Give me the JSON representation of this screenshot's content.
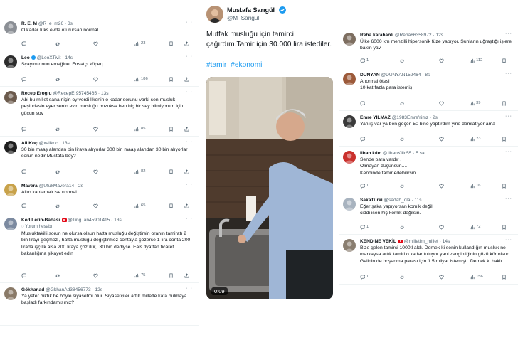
{
  "left_tweets": [
    {
      "name": "R. E. M",
      "handle": "@R_e_m26",
      "time": "3s",
      "flag": false,
      "text": "O kadar lüks evde oturursan normal",
      "note": "",
      "views": "23"
    },
    {
      "name": "Leo",
      "handle": "@LeoXTivit",
      "time": "14s",
      "flag": false,
      "verified_icon": true,
      "text": "Sçayım onun emeğine. Fırsatçı köpeq",
      "note": "",
      "views": "186"
    },
    {
      "name": "Recep Eroglu",
      "handle": "@RecepEr95745465",
      "time": "13s",
      "flag": false,
      "text": "Abi bu millet sana niçin oy verdi likenin o kadar sorunu varki sen musluk peşindesin eyer senin evin musluğu bozuksa ben hiç bir sey bilmiyorum için gücun sov",
      "note": "",
      "views": "85"
    },
    {
      "name": "Ali Koç",
      "handle": "@xalikoc",
      "time": "13s",
      "flag": false,
      "text": "30 bin maaş alandan bin liraya alıyorlar 300 bin maaş alandan 30 bin alıyorlar sorun nedir Mustafa bey?",
      "note": "",
      "views": "82"
    },
    {
      "name": "Mavera",
      "handle": "@UfukMavera14",
      "time": "2s",
      "flag": false,
      "text": "Altın kaplamalı ise normal",
      "note": "",
      "views": "65"
    },
    {
      "name": "KediLerin-Babası",
      "handle": "@TingTan45901415",
      "time": "13s",
      "flag": true,
      "text": "Musluktakilli sorun ne olursa olsun  hatta musluğu değiştirsin oranın tamiratı 2 bin lirayı geçmez , hatta musluğu değiştirmez contayla çözerse 1 lira conta 200 lirada işçilik alsa 200 liraya çözülür,, 30 bin dedlyse. Fals flyattan ticaret bakanlığına şikayet edin",
      "note": "Yorum hesabı",
      "views": "75"
    },
    {
      "name": "Gökhanad",
      "handle": "@GkhanAd38456773",
      "time": "12s",
      "flag": false,
      "text": "Ya yeter bıktık be böyle siyasetmi olur. Siyasetçiler artık milletle kafa bulmaya başladı farkındamısınız?",
      "note": "",
      "views": ""
    }
  ],
  "main_post": {
    "name": "Mustafa Sarıgül",
    "handle": "@M_Sarigul",
    "text": "Mutfak musluğu için tamirci çağırdım.Tamir için 30.000 lira istediler.",
    "hashtags": [
      "#tamir",
      "#ekonomi"
    ],
    "video_duration": "0:09"
  },
  "right_tweets": [
    {
      "name": "Reha karahanlı",
      "handle": "@Reha86358972",
      "time": "12s",
      "flag": false,
      "text": "Ülke 6000 km menzilli hipersonik füze yapıyor. Şunların uğraştığı işlere bakın yav",
      "replies": "1",
      "views": "112"
    },
    {
      "name": "DUNYAN",
      "handle": "@DUNYAN152464",
      "time": "8s",
      "flag": false,
      "text": "Anormal ötesi\n10 kat fazla para istemiş",
      "replies": "",
      "views": "39"
    },
    {
      "name": "Emre YILMAZ",
      "handle": "@1983EmreYimz",
      "time": "2s",
      "flag": false,
      "text": "Yanlış var ya ben geçen 50 bine yaptırdım yine damlatıyor ama",
      "replies": "",
      "views": "23"
    },
    {
      "name": "ilhan kılıc",
      "handle": "@IlhanKilic55",
      "time": "5 sa",
      "flag": false,
      "text": "Sende para vardır ,\nOlmayan düşünsün....\nKendinde tamir edebilirsin.",
      "replies": "1",
      "views": "16"
    },
    {
      "name": "SakaTürki",
      "handle": "@sadab_ola",
      "time": "11s",
      "flag": false,
      "text": "Eğer şaka yapıyorsan komik değil,\nciddi isen hiç komik değilsin.",
      "replies": "1",
      "views": "72"
    },
    {
      "name": "KENDİNE VEKİL",
      "handle": "@milletim_millet",
      "time": "14s",
      "flag": true,
      "text": "Bize gelen tamirci 1000tl aldı. Demek ki senin kullandığın musluk ne markaysa artık tamiri o kadar tutuyor yani zenginliğinin gözü kör olsun. Gelinin de boşanma parası için 1.5 milyar istemişti. Demek ki haklı.",
      "replies": "1",
      "views": "156"
    }
  ],
  "colors": {
    "accent": "#1d9bf0",
    "text_primary": "#0f1419",
    "text_secondary": "#536471",
    "divider": "#eff3f4",
    "flag_red": "#e30a17"
  }
}
